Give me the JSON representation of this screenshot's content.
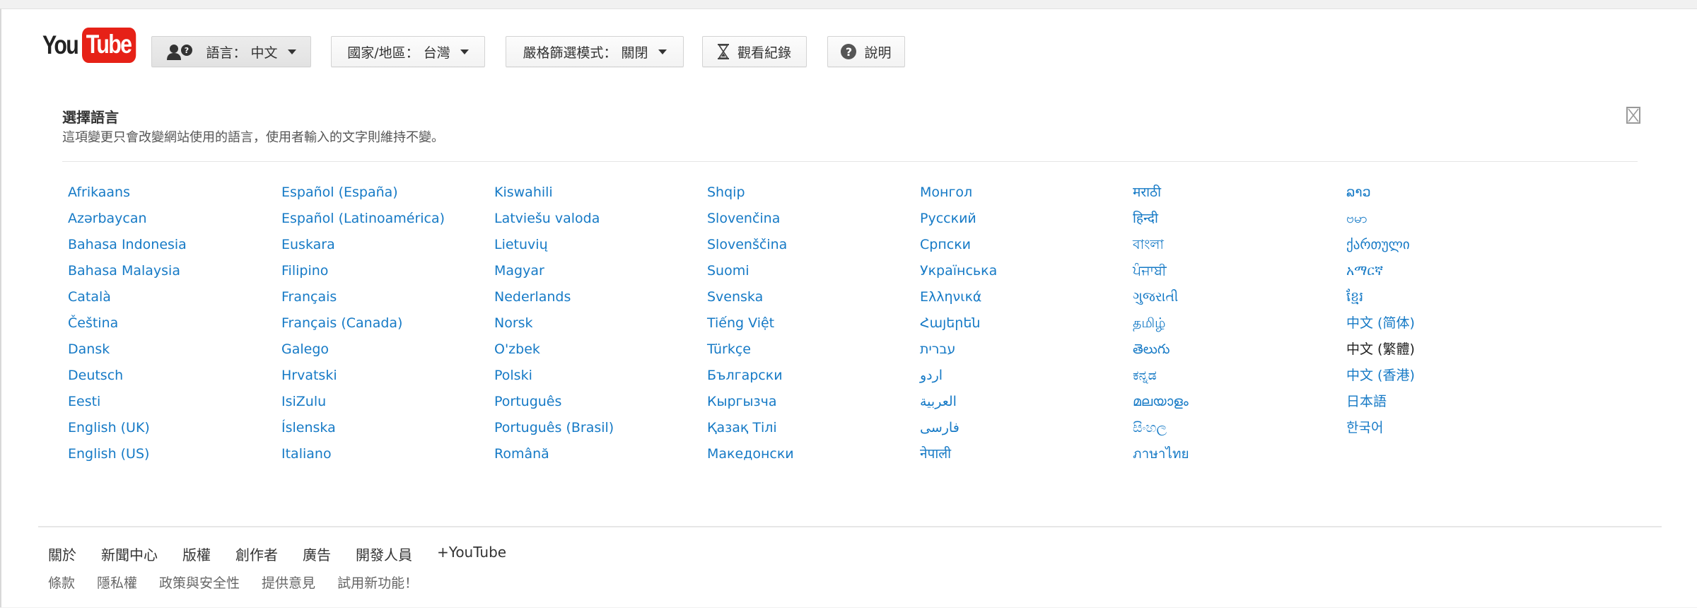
{
  "header": {
    "logo_you": "You",
    "logo_tube": "Tube",
    "language_button": "語言： 中文",
    "country_button": "國家/地區： 台灣",
    "restricted_button": "嚴格篩選模式： 關閉",
    "history_button": "觀看紀錄",
    "help_button": "說明"
  },
  "panel": {
    "title": "選擇語言",
    "subtitle": "這項變更只會改變網站使用的語言，使用者輸入的文字則維持不變。",
    "current_language": "中文 (繁體)"
  },
  "languages": [
    [
      "Afrikaans",
      "Azərbaycan",
      "Bahasa Indonesia",
      "Bahasa Malaysia",
      "Català",
      "Čeština",
      "Dansk",
      "Deutsch",
      "Eesti",
      "English (UK)",
      "English (US)"
    ],
    [
      "Español (España)",
      "Español (Latinoamérica)",
      "Euskara",
      "Filipino",
      "Français",
      "Français (Canada)",
      "Galego",
      "Hrvatski",
      "IsiZulu",
      "Íslenska",
      "Italiano"
    ],
    [
      "Kiswahili",
      "Latviešu valoda",
      "Lietuvių",
      "Magyar",
      "Nederlands",
      "Norsk",
      "O'zbek",
      "Polski",
      "Português",
      "Português (Brasil)",
      "Română"
    ],
    [
      "Shqip",
      "Slovenčina",
      "Slovenščina",
      "Suomi",
      "Svenska",
      "Tiếng Việt",
      "Türkçe",
      "Български",
      "Кыргызча",
      "Қазақ Тілі",
      "Македонски"
    ],
    [
      "Монгол",
      "Русский",
      "Српски",
      "Українська",
      "Ελληνικά",
      "Հայերեն",
      "עברית",
      "اردو",
      "العربية",
      "فارسی",
      "नेपाली"
    ],
    [
      "मराठी",
      "हिन्दी",
      "বাংলা",
      "ਪੰਜਾਬੀ",
      "ગુજરાતી",
      "தமிழ்",
      "తెలుగు",
      "ಕನ್ನಡ",
      "മലയാളം",
      "සිංහල",
      "ภาษาไทย"
    ],
    [
      "ລາວ",
      "ဗမာ",
      "ქართული",
      "አማርኛ",
      "ខ្មែរ",
      "中文 (简体)",
      "中文 (繁體)",
      "中文 (香港)",
      "日本語",
      "한국어"
    ]
  ],
  "footer": {
    "primary": [
      "關於",
      "新聞中心",
      "版權",
      "創作者",
      "廣告",
      "開發人員",
      "+YouTube"
    ],
    "secondary": [
      "條款",
      "隱私權",
      "政策與安全性",
      "提供意見",
      "試用新功能！"
    ]
  }
}
